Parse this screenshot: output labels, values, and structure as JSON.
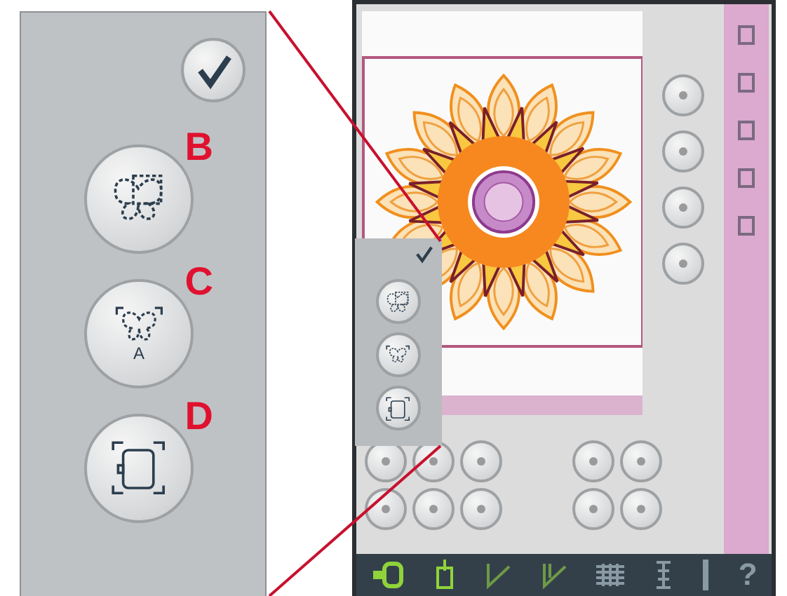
{
  "callout": {
    "buttons": [
      {
        "kind": "confirm"
      },
      {
        "kind": "move",
        "label": "B"
      },
      {
        "kind": "fit",
        "label": "C",
        "icon_text": "A"
      },
      {
        "kind": "hoop",
        "label": "D"
      }
    ]
  },
  "popup": {
    "buttons": [
      {
        "kind": "confirm"
      },
      {
        "kind": "move"
      },
      {
        "kind": "fit"
      },
      {
        "kind": "hoop"
      }
    ]
  },
  "taskbar": {
    "items": [
      {
        "kind": "hoop"
      },
      {
        "kind": "bobbin"
      },
      {
        "kind": "needle"
      },
      {
        "kind": "needle2"
      },
      {
        "kind": "grid"
      },
      {
        "kind": "tension"
      },
      {
        "kind": "bar"
      },
      {
        "kind": "help",
        "text": "?"
      }
    ]
  }
}
